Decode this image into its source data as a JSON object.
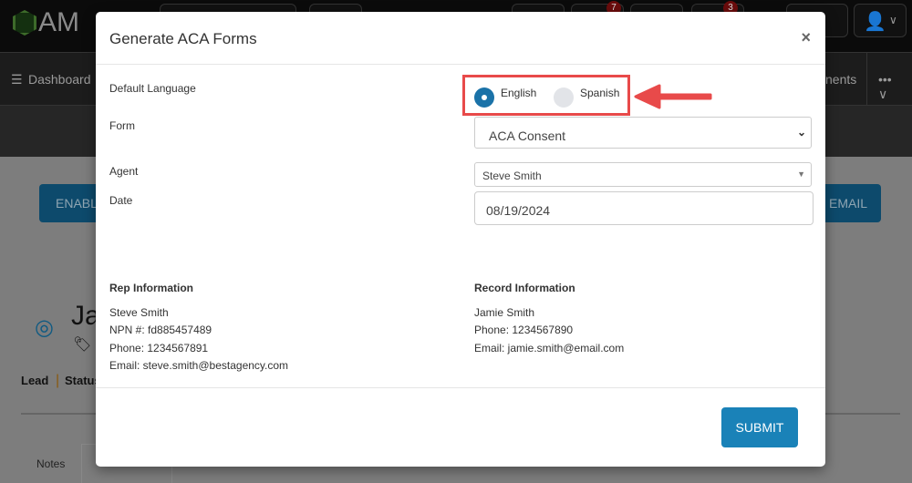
{
  "background": {
    "logo_text": "AM",
    "badges": [
      "7",
      "3"
    ],
    "nav": {
      "dashboard": "Dashboard",
      "right_item": "nents"
    },
    "buttons": {
      "left": "ENABL",
      "right": "EMAIL"
    },
    "record_name": "Ja",
    "lead_label": "Lead",
    "status_label": "Status",
    "tabs": {
      "notes": "Notes"
    }
  },
  "modal": {
    "title": "Generate ACA Forms",
    "close_label": "×",
    "fields": {
      "language_label": "Default Language",
      "language_options": [
        {
          "label": "English",
          "selected": true
        },
        {
          "label": "Spanish",
          "selected": false
        }
      ],
      "form_label": "Form",
      "form_value": "ACA Consent",
      "agent_label": "Agent",
      "agent_value": "Steve Smith",
      "date_label": "Date",
      "date_value": "08/19/2024"
    },
    "rep": {
      "heading": "Rep Information",
      "name": "Steve Smith",
      "npn": "NPN #: fd885457489",
      "phone": "Phone: 1234567891",
      "email": "Email: steve.smith@bestagency.com"
    },
    "record": {
      "heading": "Record Information",
      "name": "Jamie Smith",
      "phone": "Phone: 1234567890",
      "email": "Email: jamie.smith@email.com"
    },
    "submit_label": "SUBMIT"
  },
  "colors": {
    "accent": "#1a82b8",
    "highlight": "#e84a4a"
  }
}
